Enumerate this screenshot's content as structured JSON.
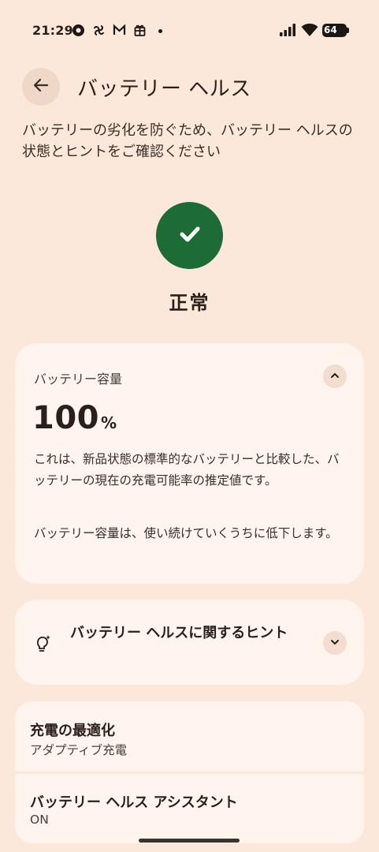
{
  "status_bar": {
    "time": "21:29",
    "battery": "64"
  },
  "header": {
    "title": "バッテリー ヘルス"
  },
  "description": "バッテリーの劣化を防ぐため、バッテリー ヘルスの状態とヒントをご確認ください",
  "health": {
    "status": "正常"
  },
  "capacity": {
    "label": "バッテリー容量",
    "value": "100",
    "unit": "%",
    "text1": "これは、新品状態の標準的なバッテリーと比較した、バッテリーの現在の充電可能率の推定値です。",
    "text2": "バッテリー容量は、使い続けていくうちに低下します。"
  },
  "hints": {
    "label": "バッテリー ヘルスに関するヒント"
  },
  "optimization": {
    "title": "充電の最適化",
    "subtitle": "アダプティブ充電"
  },
  "assistant": {
    "title": "バッテリー ヘルス アシスタント",
    "subtitle": "ON"
  },
  "colors": {
    "background": "#fbe8db",
    "card": "#fff4ee",
    "status_ok": "#1d6b35"
  },
  "icons": [
    "back-arrow-icon",
    "check-icon",
    "chevron-up-icon",
    "lightbulb-icon",
    "chevron-down-icon",
    "signal-icon",
    "wifi-icon",
    "battery-icon"
  ]
}
